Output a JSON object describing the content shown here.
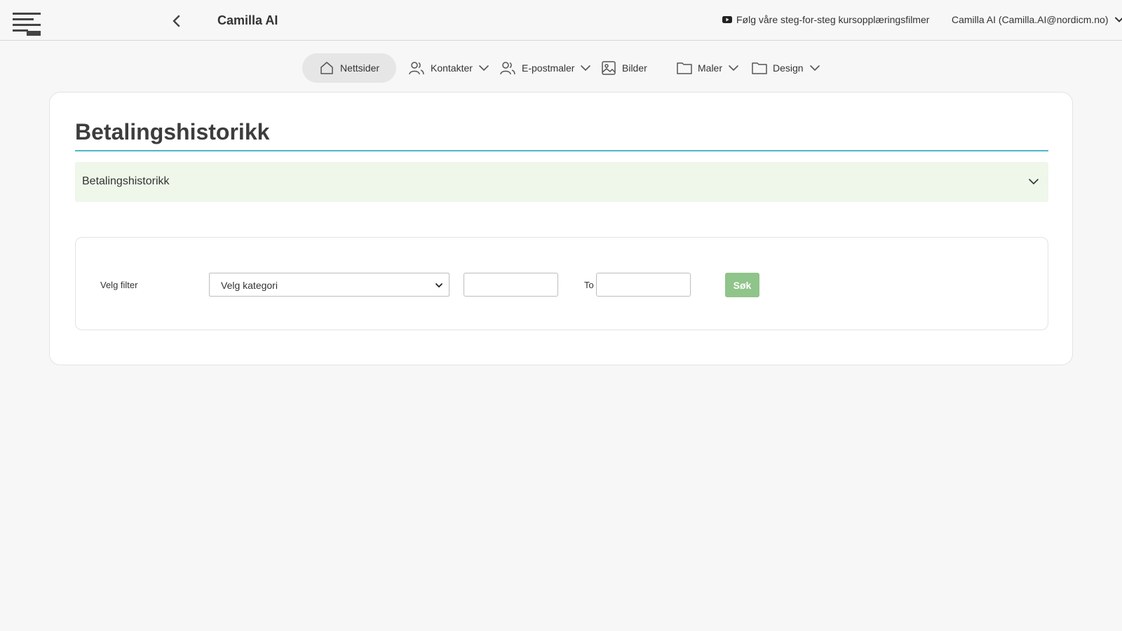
{
  "header": {
    "app_title": "Camilla AI",
    "video_link": "Følg våre steg-for-steg kursopplæringsfilmer",
    "user_label": "Camilla AI (Camilla.AI@nordicm.no)"
  },
  "nav": {
    "items": [
      {
        "label": "Nettsider",
        "icon": "home-icon",
        "active": true
      },
      {
        "label": "Kontakter",
        "icon": "users-icon",
        "dropdown": true
      },
      {
        "label": "E-postmaler",
        "icon": "users-icon",
        "dropdown": true
      },
      {
        "label": "Bilder",
        "icon": "image-icon"
      },
      {
        "label": "Maler",
        "icon": "folder-icon",
        "dropdown": true
      },
      {
        "label": "Design",
        "icon": "folder-icon",
        "dropdown": true
      }
    ]
  },
  "page": {
    "title": "Betalingshistorikk",
    "accordion_label": "Betalingshistorikk"
  },
  "filter": {
    "label": "Velg filter",
    "category_selected": "Velg kategori",
    "date_from_value": "",
    "to_label": "To",
    "date_to_value": "",
    "search_label": "Søk"
  },
  "colors": {
    "accent_rule": "#4db6cc",
    "accordion_bg": "#eef7ea",
    "search_button": "#8fc48a",
    "active_nav_bg": "#e6e6e6"
  }
}
